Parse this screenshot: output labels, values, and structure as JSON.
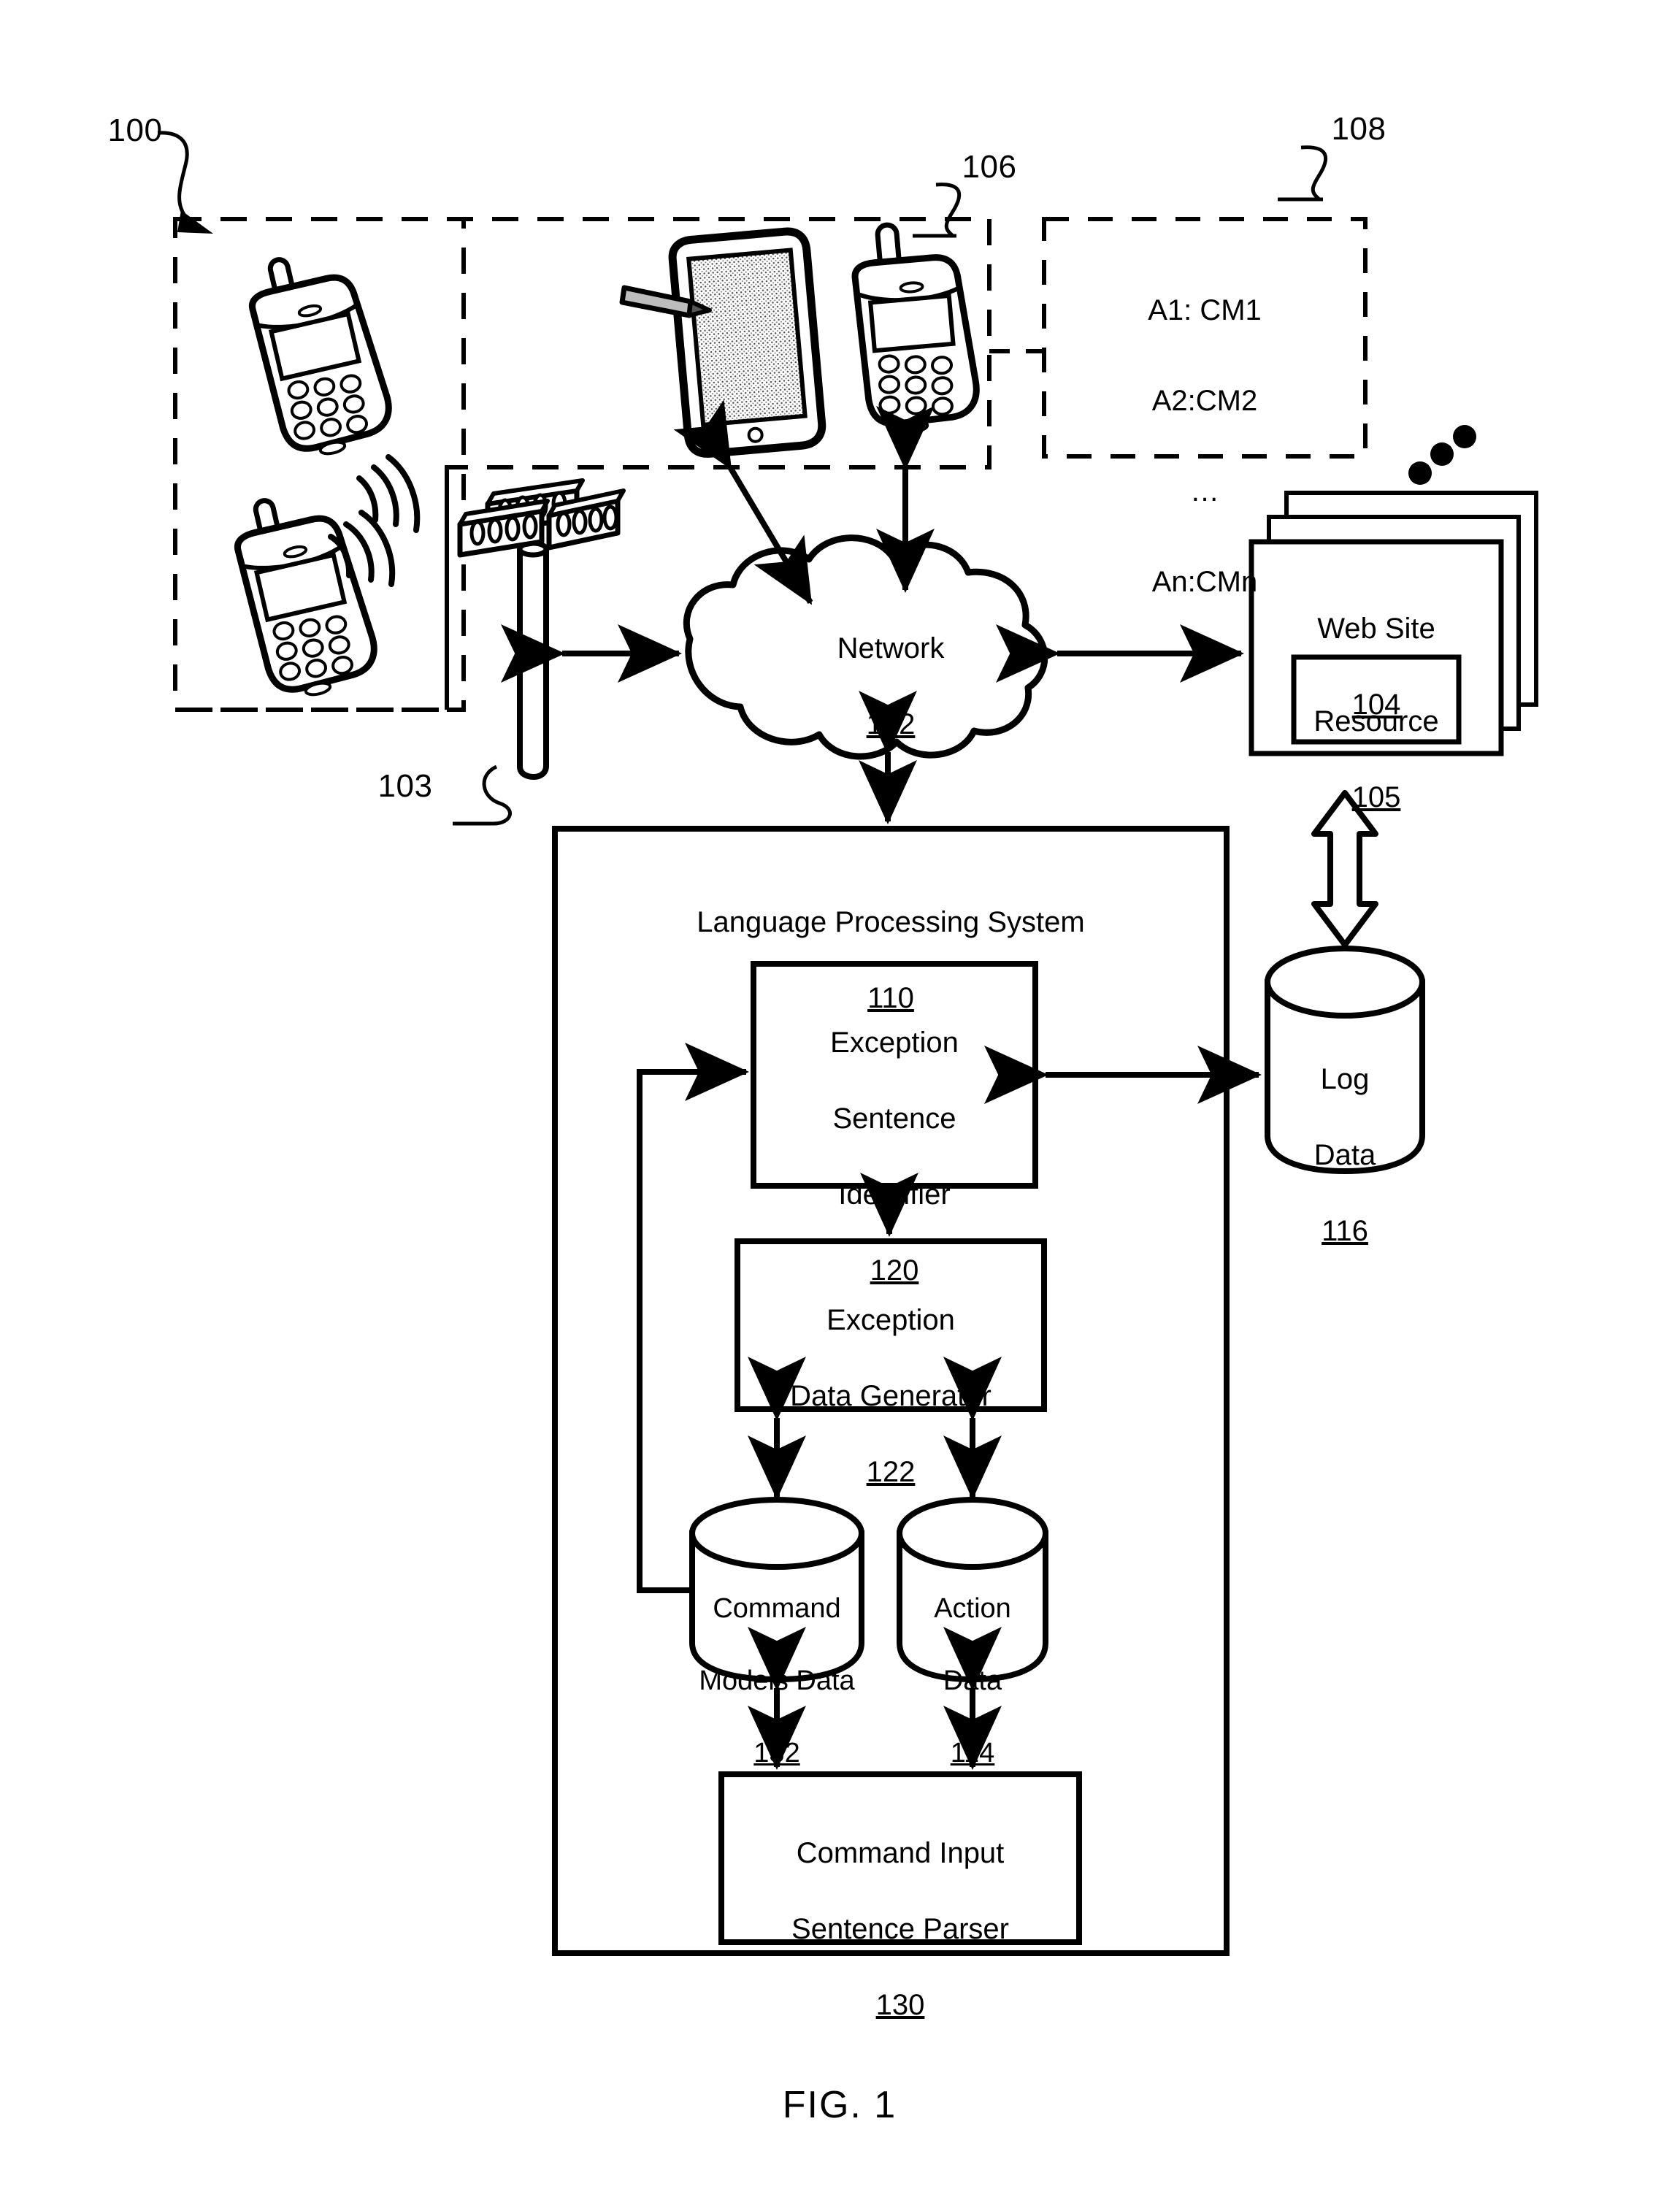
{
  "figure": {
    "caption": "FIG. 1",
    "system_ref": "100"
  },
  "refs": {
    "system": "100",
    "client_devices_group": "106",
    "command_model_list": "108",
    "cell_tower": "103"
  },
  "command_model_list": {
    "ref": "108",
    "lines": [
      "A1: CM1",
      "A2:CM2",
      "…",
      "An:CMn"
    ]
  },
  "network": {
    "label": "Network",
    "ref": "102"
  },
  "website": {
    "label": "Web Site",
    "ref": "104",
    "resource": {
      "label": "Resource",
      "ref": "105"
    }
  },
  "log_data": {
    "label_line1": "Log",
    "label_line2": "Data",
    "ref": "116"
  },
  "language_processing_system": {
    "title": "Language Processing System",
    "ref": "110",
    "blocks": [
      {
        "name": "exception-sentence-identifier",
        "lines": [
          "Exception",
          "Sentence",
          "Identifier"
        ],
        "ref": "120"
      },
      {
        "name": "exception-data-generator",
        "lines": [
          "Exception",
          "Data Generator"
        ],
        "ref": "122"
      },
      {
        "name": "command-input-sentence-parser",
        "lines": [
          "Command Input",
          "Sentence Parser"
        ],
        "ref": "130"
      }
    ],
    "datastores": [
      {
        "name": "command-models-data",
        "lines": [
          "Command",
          "Models Data"
        ],
        "ref": "132"
      },
      {
        "name": "action-data",
        "lines": [
          "Action",
          "Data"
        ],
        "ref": "114"
      }
    ]
  },
  "devices": {
    "mobile_phone_1": "mobile-phone-icon",
    "mobile_phone_2": "mobile-phone-icon",
    "mobile_phone_3": "mobile-phone-icon",
    "tablet": "tablet-with-stylus-icon",
    "cell_tower": "cell-tower-icon"
  },
  "colors": {
    "stroke": "#000000",
    "fill": "#ffffff"
  }
}
